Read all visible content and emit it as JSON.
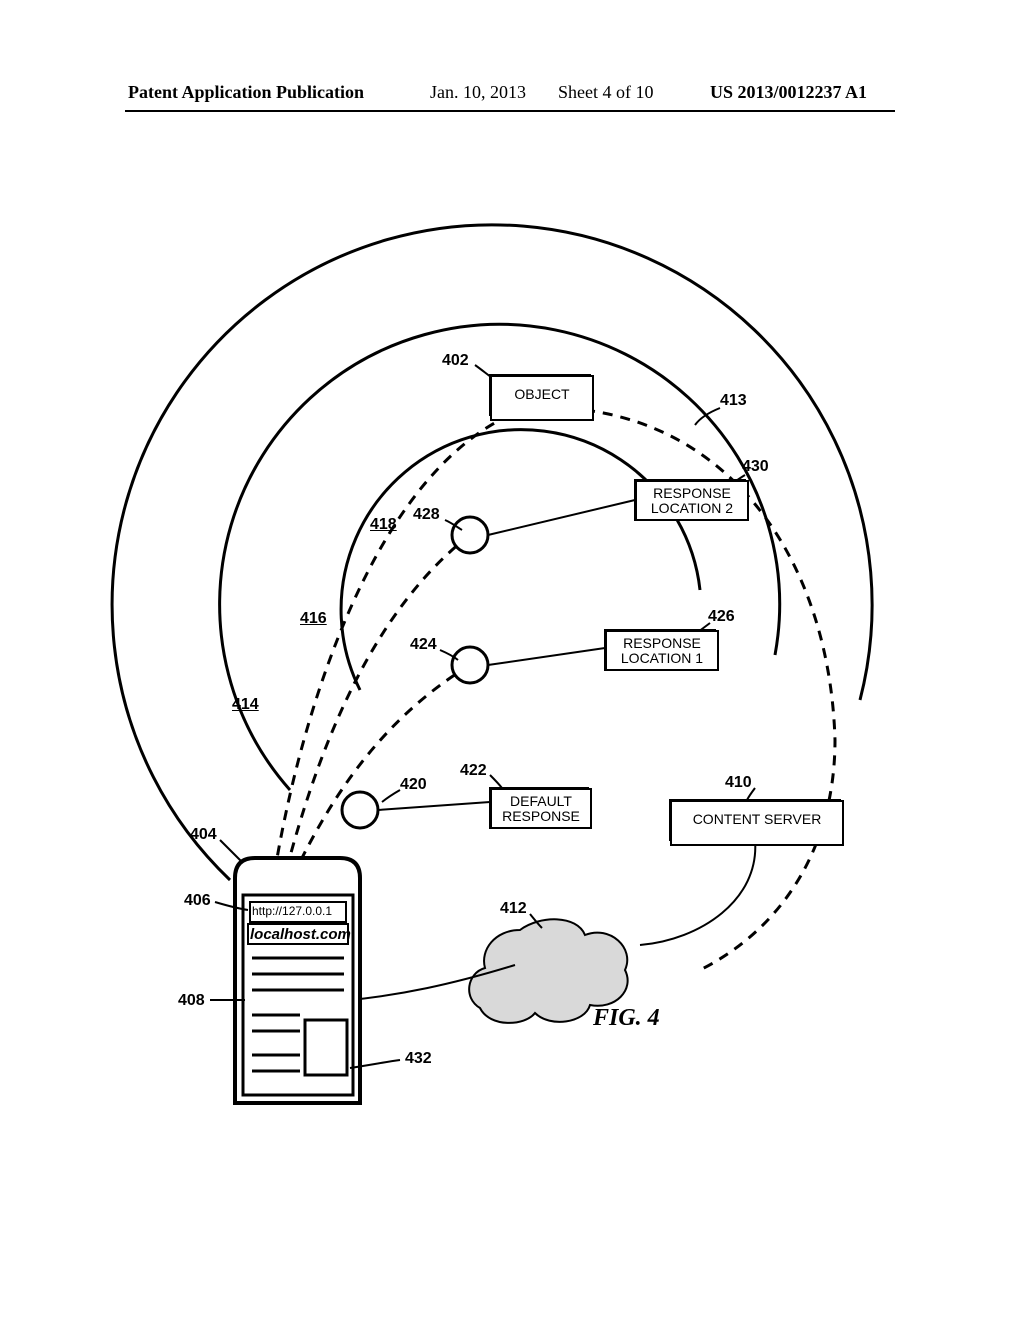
{
  "header": {
    "left": "Patent Application Publication",
    "date": "Jan. 10, 2013",
    "sheet": "Sheet 4 of 10",
    "pub": "US 2013/0012237 A1"
  },
  "refs": {
    "r402": "402",
    "r404": "404",
    "r406": "406",
    "r408": "408",
    "r410": "410",
    "r412": "412",
    "r413": "413",
    "r414": "414",
    "r416": "416",
    "r418": "418",
    "r420": "420",
    "r422": "422",
    "r424": "424",
    "r426": "426",
    "r428": "428",
    "r430": "430",
    "r432": "432"
  },
  "labels": {
    "object": "OBJECT",
    "response2": "RESPONSE\nLOCATION 2",
    "response1": "RESPONSE\nLOCATION 1",
    "default_resp": "DEFAULT\nRESPONSE",
    "content_server": "CONTENT SERVER"
  },
  "device": {
    "url": "http://127.0.0.1",
    "domain": "localhost.com"
  },
  "figure": "FIG. 4"
}
